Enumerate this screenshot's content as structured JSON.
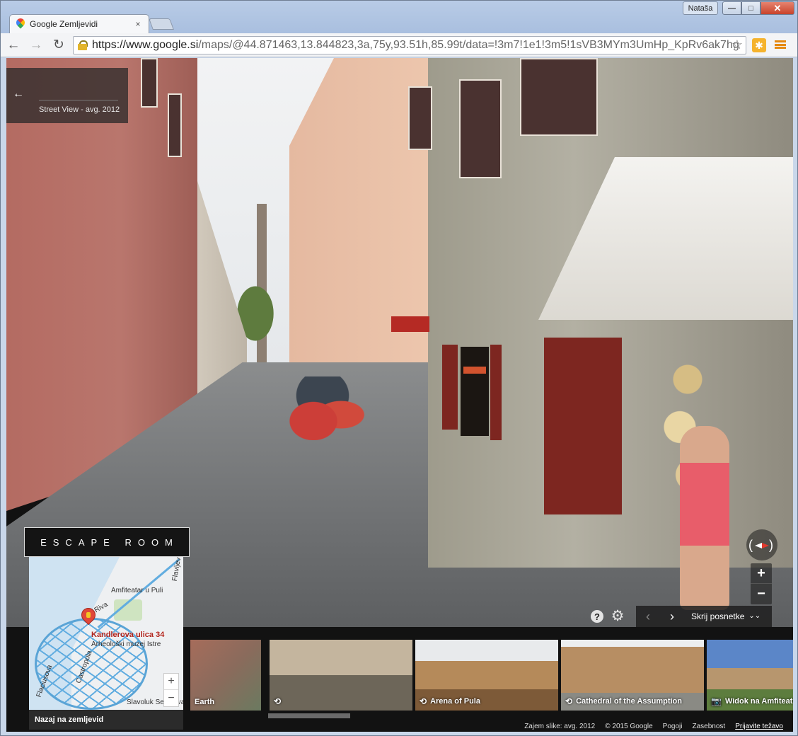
{
  "browser": {
    "tab_title": "Google Zemljevidi",
    "tab_close": "×",
    "user": "Nataša",
    "win_min": "—",
    "win_max": "□",
    "win_close": "✕",
    "back": "←",
    "forward": "→",
    "reload": "↻",
    "url_host": "https://www.google.si",
    "url_path": "/maps/@44.871463,13.844823,3a,75y,93.51h,85.99t/data=!3m7!1e1!3m5!1sVB3MYm3UmHp_KpRv6ak7hg",
    "star": "☆",
    "extension": "✱",
    "colors": {
      "titlebar": "#b8cbe6",
      "close": "#c8432b",
      "menu": "#e58a12"
    }
  },
  "header": {
    "back_arrow": "←",
    "subtitle": "Street View - avg. 2012"
  },
  "controls": {
    "help": "?",
    "gear": "⚙",
    "prev": "‹",
    "next": "›",
    "toggle_label": "Skrij posnetke",
    "chevrons": "⌄⌄",
    "zoom_in": "+",
    "zoom_out": "−"
  },
  "minimap": {
    "banner": "ESCAPE ROOM",
    "labels": {
      "amfiteatar": "Amfiteatar u Puli",
      "flavijevska": "Flavijev",
      "riva": "Riva",
      "muzej": "Arheološki muzej Istre",
      "castrapola": "Castropola",
      "flaciusova": "Flaciusova",
      "slavoluk": "Slavoluk Sergijevaca"
    },
    "address": "Kandlerova ulica 34",
    "zoom_in": "+",
    "zoom_out": "−",
    "back_label": "Nazaj na zemljevid"
  },
  "filmstrip": {
    "thumbs": [
      {
        "label": "Earth",
        "icon": ""
      },
      {
        "label": "",
        "icon": "⟲"
      },
      {
        "label": "Arena of Pula",
        "icon": "⟲"
      },
      {
        "label": "Cathedral of the Assumption",
        "icon": "⟲"
      },
      {
        "label": "Widok na Amfiteatr",
        "icon": "📷"
      }
    ]
  },
  "footer": {
    "image_date": "Zajem slike: avg. 2012",
    "copyright": "© 2015 Google",
    "terms": "Pogoji",
    "privacy": "Zasebnost",
    "report": "Prijavite težavo"
  }
}
